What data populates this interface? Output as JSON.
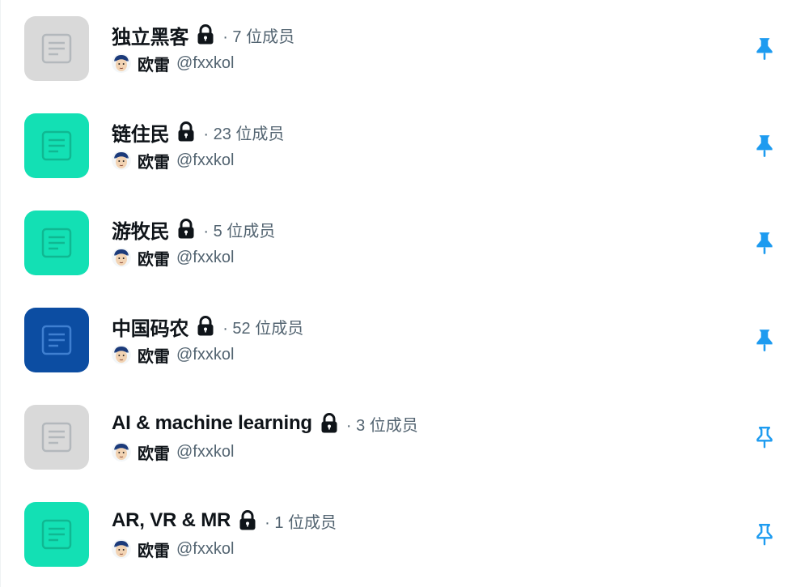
{
  "colors": {
    "thumb_gray": "#d9d9d9",
    "thumb_teal": "#13e0b4",
    "thumb_navy": "#0c4da2",
    "pin_blue": "#1d9bf0",
    "text_primary": "#0f1419",
    "text_secondary": "#536471"
  },
  "lists": [
    {
      "name": "独立黑客",
      "member_count": "· 7 位成员",
      "owner_name": "欧雷",
      "owner_handle": "@fxxkol",
      "thumb_color": "#d9d9d9",
      "icon_color": "#b3b8bc",
      "pinned": true,
      "lock_icon": "lock-icon",
      "pin_icon": "pin-filled-icon"
    },
    {
      "name": "链住民",
      "member_count": "· 23 位成员",
      "owner_name": "欧雷",
      "owner_handle": "@fxxkol",
      "thumb_color": "#13e0b4",
      "icon_color": "#0fb892",
      "pinned": true,
      "lock_icon": "lock-icon",
      "pin_icon": "pin-filled-icon"
    },
    {
      "name": "游牧民",
      "member_count": "· 5 位成员",
      "owner_name": "欧雷",
      "owner_handle": "@fxxkol",
      "thumb_color": "#13e0b4",
      "icon_color": "#0fb892",
      "pinned": true,
      "lock_icon": "lock-icon",
      "pin_icon": "pin-filled-icon"
    },
    {
      "name": "中国码农",
      "member_count": "· 52 位成员",
      "owner_name": "欧雷",
      "owner_handle": "@fxxkol",
      "thumb_color": "#0c4da2",
      "icon_color": "#3f7fd0",
      "pinned": true,
      "lock_icon": "lock-icon",
      "pin_icon": "pin-filled-icon"
    },
    {
      "name": "AI & machine learning",
      "member_count": "· 3 位成员",
      "owner_name": "欧雷",
      "owner_handle": "@fxxkol",
      "thumb_color": "#d9d9d9",
      "icon_color": "#b3b8bc",
      "pinned": false,
      "lock_icon": "lock-icon",
      "pin_icon": "pin-outline-icon"
    },
    {
      "name": "AR, VR & MR",
      "member_count": "· 1 位成员",
      "owner_name": "欧雷",
      "owner_handle": "@fxxkol",
      "thumb_color": "#13e0b4",
      "icon_color": "#0fb892",
      "pinned": false,
      "lock_icon": "lock-icon",
      "pin_icon": "pin-outline-icon"
    }
  ]
}
